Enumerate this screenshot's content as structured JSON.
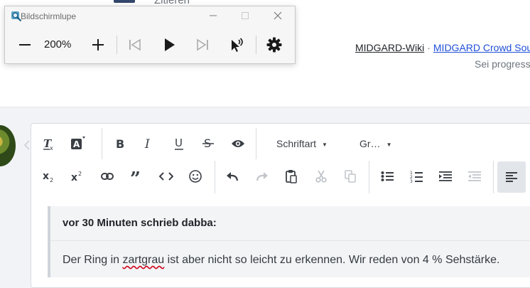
{
  "page": {
    "tab_partial": "Zitieren",
    "link_wiki": "MIDGARD-Wiki",
    "link_separator": "·",
    "link_crowd": "MIDGARD Crowd Sou",
    "progress_note": "Sei progress"
  },
  "magnifier": {
    "title": "Bildschirmlupe",
    "zoom_level": "200%",
    "buttons": [
      "zoom-out",
      "zoom-in",
      "previous",
      "play",
      "next",
      "read-from-here",
      "settings"
    ]
  },
  "editor": {
    "font_dropdown": "Schriftart",
    "size_dropdown": "Gr…",
    "quote_header": "vor 30 Minuten schrieb dabba:",
    "quote_text_before": "Der Ring in ",
    "quote_text_misspelled": "zartgrau",
    "quote_text_after": " ist aber nicht so leicht zu erkennen. Wir reden von 4 % Sehstärke."
  },
  "colors": {
    "link_blue": "#1f4fd8",
    "accent_dark": "#33466b",
    "spellcheck_red": "#d0021b"
  }
}
